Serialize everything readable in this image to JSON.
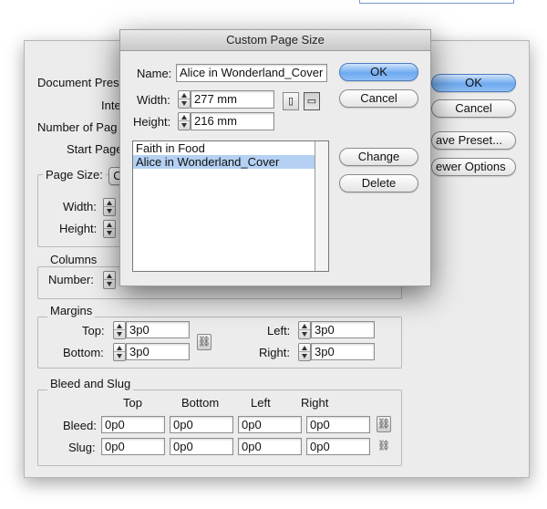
{
  "bg_dialog": {
    "labels": {
      "document_preset": "Document Pres",
      "intent": "Inte",
      "number_of_pages": "Number of Pag",
      "start_page": "Start Page",
      "page_size": "Page Size:",
      "page_size_select": "C",
      "width": "Width:",
      "height": "Height:"
    },
    "buttons": {
      "ok": "OK",
      "cancel": "Cancel",
      "save_preset": "ave Preset...",
      "fewer_options": "ewer Options"
    },
    "columns": {
      "title": "Columns",
      "number_label": "Number:"
    },
    "margins": {
      "title": "Margins",
      "top_label": "Top:",
      "top_value": "3p0",
      "bottom_label": "Bottom:",
      "bottom_value": "3p0",
      "left_label": "Left:",
      "left_value": "3p0",
      "right_label": "Right:",
      "right_value": "3p0"
    },
    "bleed_slug": {
      "title": "Bleed and Slug",
      "headers": [
        "Top",
        "Bottom",
        "Left",
        "Right"
      ],
      "bleed_label": "Bleed:",
      "bleed_values": [
        "0p0",
        "0p0",
        "0p0",
        "0p0"
      ],
      "slug_label": "Slug:",
      "slug_values": [
        "0p0",
        "0p0",
        "0p0",
        "0p0"
      ]
    }
  },
  "custom_page_size": {
    "title": "Custom Page Size",
    "name_label": "Name:",
    "name_value": "Alice in Wonderland_Cover",
    "width_label": "Width:",
    "width_value": "277 mm",
    "height_label": "Height:",
    "height_value": "216 mm",
    "list_items": [
      "Faith in Food",
      "Alice in Wonderland_Cover"
    ],
    "selected_item": "Alice in Wonderland_Cover",
    "buttons": {
      "ok": "OK",
      "cancel": "Cancel",
      "change": "Change",
      "delete": "Delete"
    }
  },
  "colors": {
    "accent": "#6eaaf0",
    "selection": "#b4d0f2",
    "dialog_bg": "#ececec"
  },
  "icons": [
    "stepper-icon",
    "portrait-orientation-icon",
    "landscape-orientation-icon",
    "chain-link-icon"
  ]
}
